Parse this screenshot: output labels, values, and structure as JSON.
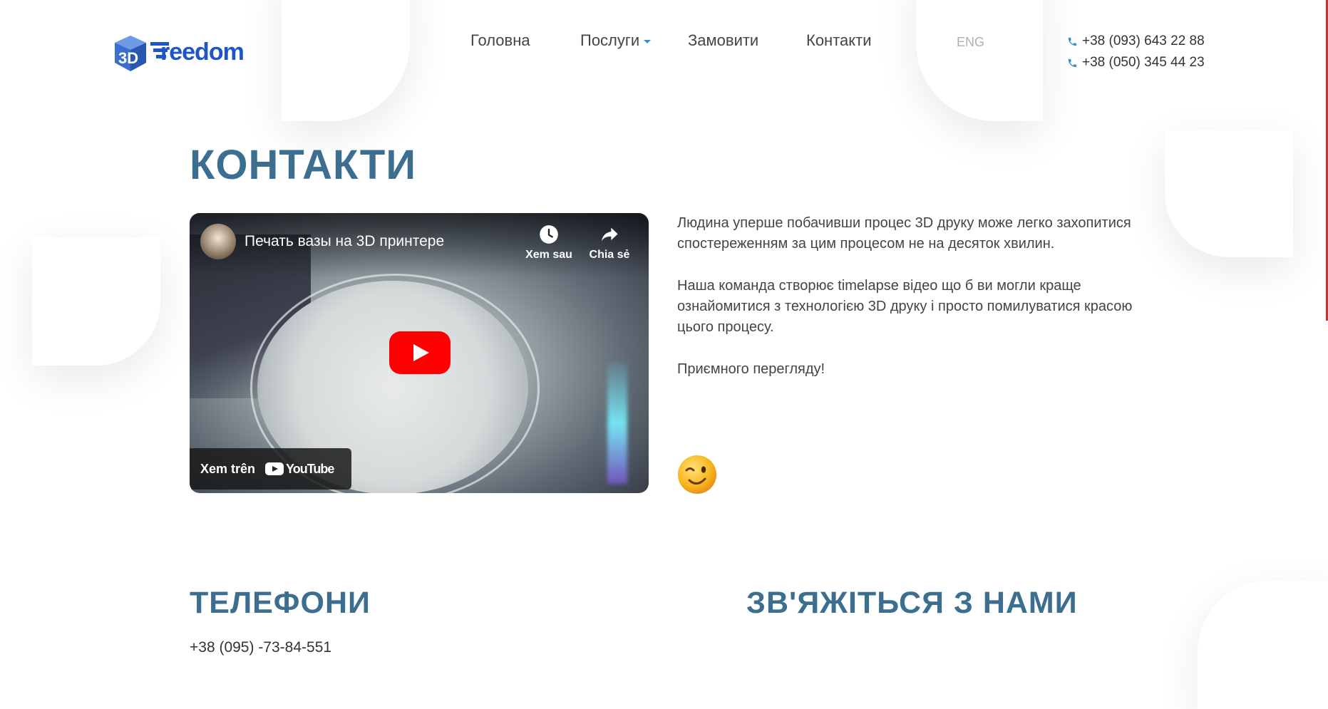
{
  "brand": {
    "logo_text_prefix": "3D",
    "logo_text": "Freedom",
    "colors": {
      "primary": "#3c6e8f",
      "accent": "#2f8fd3",
      "logo_blue": "#1e56c8",
      "cube": "#3a6fd0"
    }
  },
  "nav": {
    "items": [
      {
        "label": "Головна"
      },
      {
        "label": "Послуги",
        "has_dropdown": true
      },
      {
        "label": "Замовити"
      },
      {
        "label": "Контакти"
      }
    ],
    "lang": "ENG",
    "phones": [
      "+38 (093) 643 22 88",
      "+38 (050) 345 44 23"
    ]
  },
  "main": {
    "title": "КОНТАКТИ",
    "video": {
      "title": "Печать вазы на 3D принтере",
      "watch_later": "Xem sau",
      "share": "Chia sẻ",
      "watch_on": "Xem trên",
      "platform": "YouTube"
    },
    "description": [
      "Людина уперше побачивши процес 3D друку може легко захопитися спостереженням за цим процесом не на десяток хвилин.",
      "Наша команда створює timelapse відео що б ви могли краще ознайомитися з технологією 3D друку і просто помилуватися красою цього процесу.",
      "Приємного перегляду!"
    ],
    "emoji": "winking-face"
  },
  "sections": {
    "phones_title": "ТЕЛЕФОНИ",
    "contact_title": "ЗВ'ЯЖІТЬСЯ З НАМИ",
    "phone_first": "+38 (095) -73-84-551"
  }
}
